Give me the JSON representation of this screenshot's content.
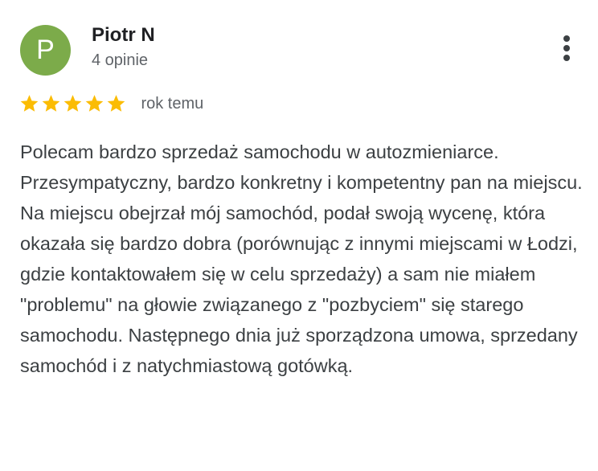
{
  "reviewer": {
    "initial": "P",
    "name": "Piotr N",
    "reviews_count": "4 opinie",
    "avatar_color": "#7cab4a"
  },
  "rating": {
    "stars": 5,
    "max": 5,
    "star_color": "#fbbc04"
  },
  "date": "rok temu",
  "review_text": "Polecam bardzo sprzedaż samochodu w autozmieniarce. Przesympatyczny, bardzo konkretny i kompetentny pan na miejscu. Na miejscu obejrzał mój samochód, podał swoją wycenę, która okazała się bardzo dobra (porównując z innymi miejscami w Łodzi, gdzie kontaktowałem się w celu sprzedaży) a sam nie miałem \"problemu\" na głowie związanego z \"pozbyciem\" się starego samochodu. Następnego dnia już sporządzona umowa, sprzedany samochód i z natychmiastową gotówką.",
  "icons": {
    "more": "more-vert-icon",
    "star": "star-icon"
  }
}
